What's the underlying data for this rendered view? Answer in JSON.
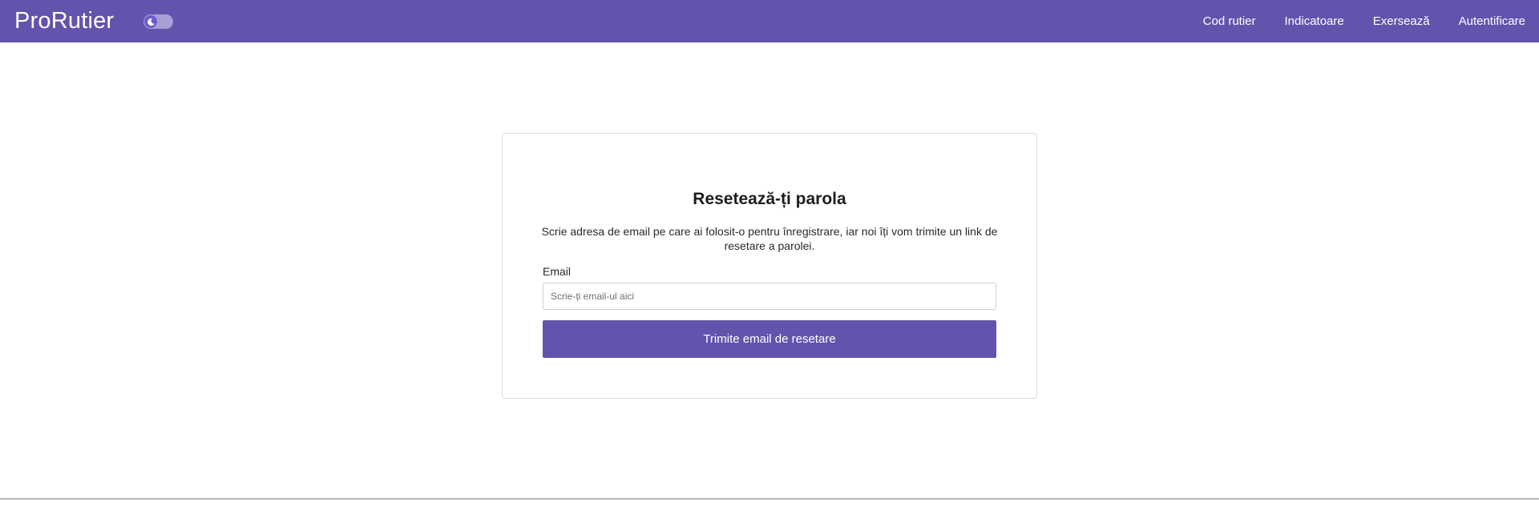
{
  "header": {
    "brand": "ProRutier",
    "theme_toggle_icon": "moon-icon",
    "nav": [
      {
        "label": "Cod rutier"
      },
      {
        "label": "Indicatoare"
      },
      {
        "label": "Exersează"
      },
      {
        "label": "Autentificare"
      }
    ]
  },
  "colors": {
    "primary": "#6353ac",
    "toggle_track": "#a89fd6"
  },
  "reset_form": {
    "title": "Resetează-ți parola",
    "description": "Scrie adresa de email pe care ai folosit-o pentru înregistrare, iar noi îți vom trimite un link de resetare a parolei.",
    "email_label": "Email",
    "email_value": "",
    "email_placeholder": "Scrie-ți email-ul aici",
    "submit_label": "Trimite email de resetare"
  }
}
